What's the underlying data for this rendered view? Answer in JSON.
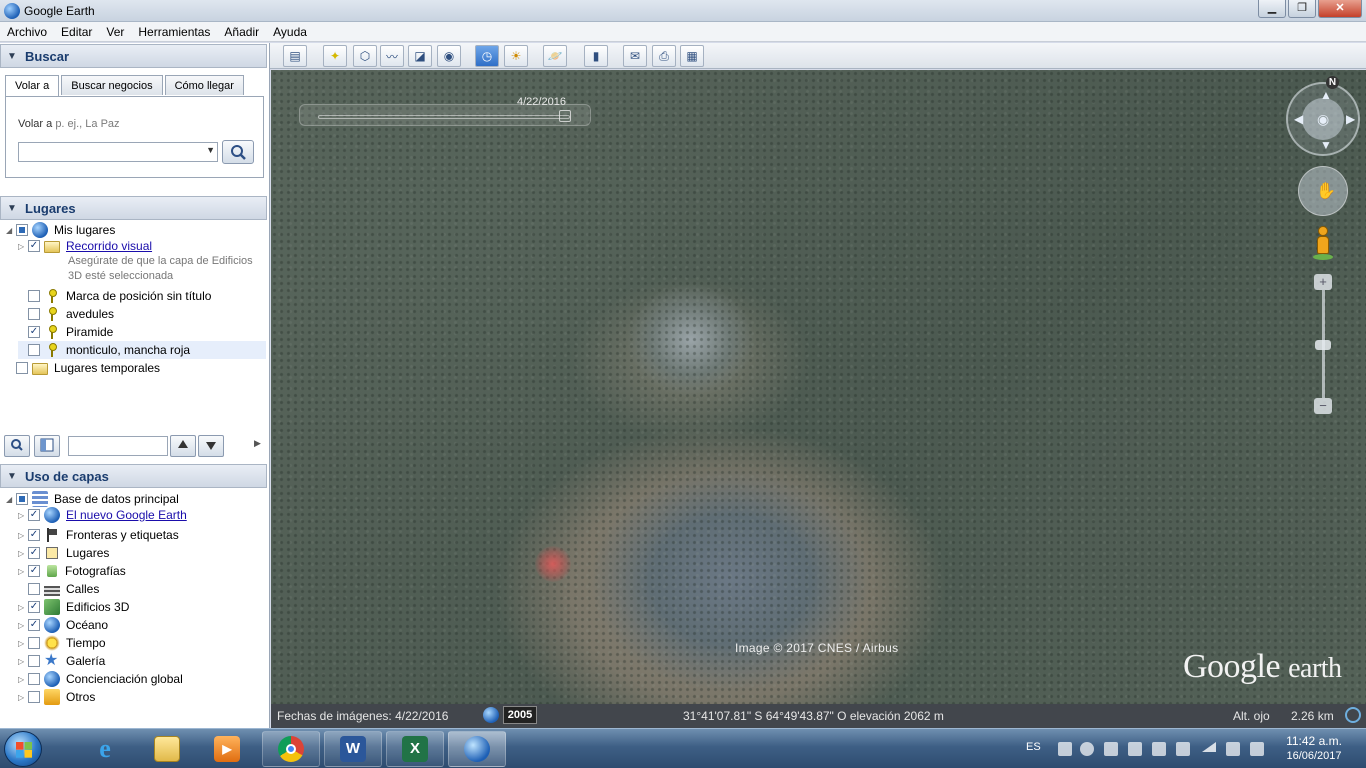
{
  "window": {
    "title": "Google Earth",
    "min": "▁",
    "max": "❐",
    "close": "✕"
  },
  "menu": [
    "Archivo",
    "Editar",
    "Ver",
    "Herramientas",
    "Añadir",
    "Ayuda"
  ],
  "search": {
    "header": "Buscar",
    "tabs": [
      "Volar a",
      "Buscar negocios",
      "Cómo llegar"
    ],
    "fly_label": "Volar a",
    "fly_placeholder": "p. ej., La Paz",
    "input_value": ""
  },
  "places": {
    "header": "Lugares",
    "items": [
      {
        "label": "Mis lugares"
      },
      {
        "label": "Recorrido visual",
        "note": "Asegúrate de que la capa de Edificios 3D esté seleccionada"
      },
      {
        "label": "Marca de posición sin título"
      },
      {
        "label": "avedules"
      },
      {
        "label": "Piramide"
      },
      {
        "label": "monticulo, mancha roja"
      },
      {
        "label": "Lugares temporales"
      }
    ]
  },
  "layers": {
    "header": "Uso de capas",
    "items": [
      {
        "label": "Base de datos principal"
      },
      {
        "label": "El nuevo Google Earth"
      },
      {
        "label": "Fronteras y etiquetas"
      },
      {
        "label": "Lugares"
      },
      {
        "label": "Fotografías"
      },
      {
        "label": "Calles"
      },
      {
        "label": "Edificios 3D"
      },
      {
        "label": "Océano"
      },
      {
        "label": "Tiempo"
      },
      {
        "label": "Galería"
      },
      {
        "label": "Concienciación global"
      },
      {
        "label": "Otros"
      }
    ]
  },
  "map": {
    "slider_date": "4/22/2016",
    "copyright": "Image © 2017 CNES / Airbus",
    "logo_main": "Google",
    "logo_sub": "earth",
    "north": "N"
  },
  "status": {
    "imagery_date": "Fechas de imágenes: 4/22/2016",
    "year": "2005",
    "coords": "31°41'07.81\" S   64°49'43.87\" O  elevación  2062 m",
    "eye_label": "Alt. ojo",
    "eye_value": "2.26 km"
  },
  "taskbar": {
    "lang": "ES",
    "time": "11:42 a.m.",
    "date": "16/06/2017"
  },
  "colors": {
    "accent": "#1a3c6e",
    "link": "#1a0dab",
    "taskbar": "#3e5f85"
  }
}
